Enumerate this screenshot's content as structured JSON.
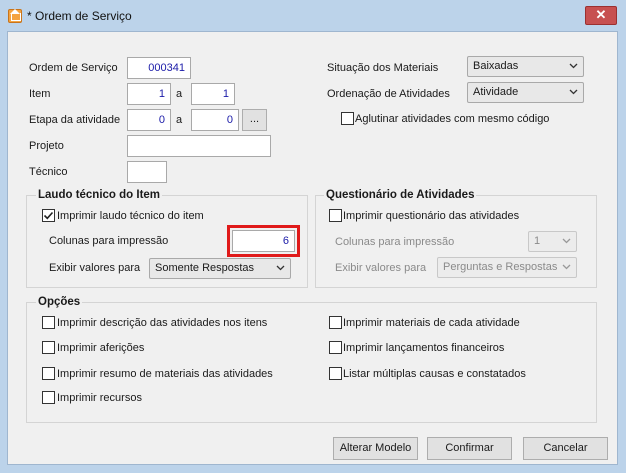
{
  "window": {
    "title": "* Ordem de Serviço",
    "close_glyph": "✕"
  },
  "form": {
    "ordem_label": "Ordem de Serviço",
    "ordem_value": "000341",
    "item_label": "Item",
    "item_from": "1",
    "item_sep": "a",
    "item_to": "1",
    "etapa_label": "Etapa da atividade",
    "etapa_from": "0",
    "etapa_sep": "a",
    "etapa_to": "0",
    "etapa_browse": "...",
    "projeto_label": "Projeto",
    "projeto_value": "",
    "tecnico_label": "Técnico",
    "tecnico_value": ""
  },
  "right": {
    "situacao_label": "Situação dos Materiais",
    "situacao_value": "Baixadas",
    "ordenacao_label": "Ordenação de Atividades",
    "ordenacao_value": "Atividade",
    "aglutinar_label": "Aglutinar atividades com mesmo código",
    "aglutinar_checked": false
  },
  "laudo": {
    "title": "Laudo técnico do Item",
    "imprimir_label": "Imprimir laudo técnico do item",
    "imprimir_checked": true,
    "colunas_label": "Colunas para impressão",
    "colunas_value": "6",
    "exibir_label": "Exibir valores para",
    "exibir_value": "Somente Respostas"
  },
  "questionario": {
    "title": "Questionário de Atividades",
    "imprimir_label": "Imprimir questionário das atividades",
    "imprimir_checked": false,
    "colunas_label": "Colunas para impressão",
    "colunas_value": "1",
    "exibir_label": "Exibir valores para",
    "exibir_value": "Perguntas e Respostas"
  },
  "opcoes": {
    "title": "Opções",
    "left": [
      "Imprimir descrição das atividades nos itens",
      "Imprimir aferições",
      "Imprimir resumo de materiais das atividades",
      "Imprimir recursos"
    ],
    "right": [
      "Imprimir materiais de cada atividade",
      "Imprimir lançamentos financeiros",
      "Listar múltiplas causas e constatados"
    ]
  },
  "buttons": {
    "alterar": "Alterar Modelo",
    "confirmar": "Confirmar",
    "cancelar": "Cancelar"
  },
  "colors": {
    "highlight": "#e01a1a",
    "value_text": "#1a1aa8"
  }
}
